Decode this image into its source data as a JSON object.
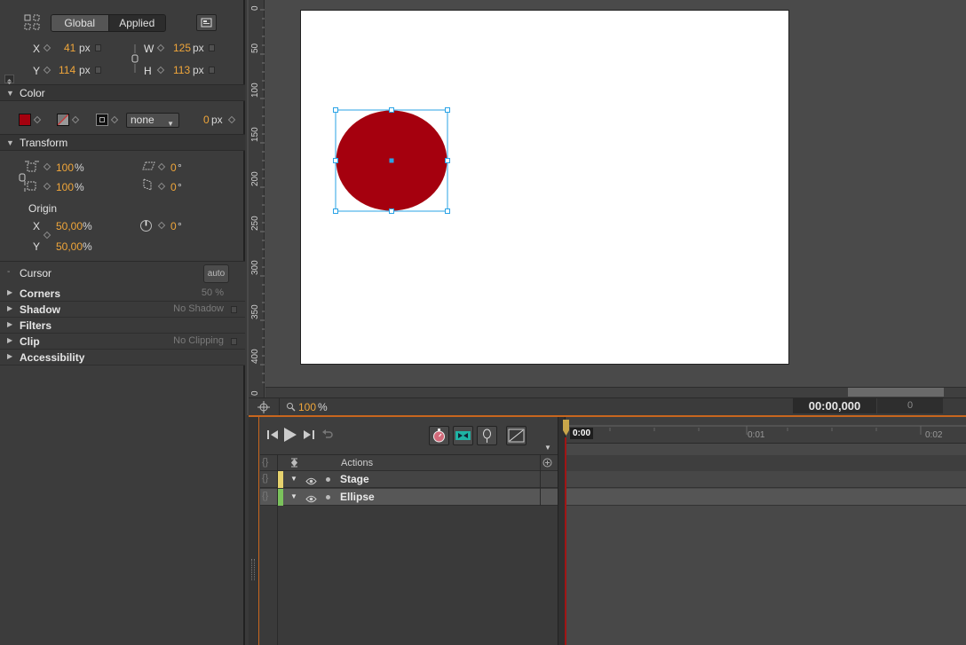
{
  "position": {
    "toggle": {
      "global": "Global",
      "applied": "Applied"
    },
    "x_label": "X",
    "x_value": "41",
    "x_unit": "px",
    "y_label": "Y",
    "y_value": "114",
    "y_unit": "px",
    "w_label": "W",
    "w_value": "125",
    "w_unit": "px",
    "h_label": "H",
    "h_value": "113",
    "h_unit": "px"
  },
  "color": {
    "section_title": "Color",
    "fill_color": "#a5000e",
    "stroke_style": "none",
    "stroke_width": "0",
    "stroke_unit": "px"
  },
  "transform": {
    "section_title": "Transform",
    "scale_x": "100",
    "scale_y": "100",
    "percent": "%",
    "skew_x": "0",
    "skew_y": "0",
    "degree": "°",
    "origin_label": "Origin",
    "origin_x_label": "X",
    "origin_x": "50,00",
    "origin_y_label": "Y",
    "origin_y": "50,00",
    "rotation": "0"
  },
  "cursor": {
    "label": "Cursor",
    "button": "auto"
  },
  "collapsed_sections": [
    {
      "title": "Corners",
      "value": "50 %"
    },
    {
      "title": "Shadow",
      "value": "No Shadow"
    },
    {
      "title": "Filters",
      "value": ""
    },
    {
      "title": "Clip",
      "value": "No Clipping"
    },
    {
      "title": "Accessibility",
      "value": ""
    }
  ],
  "ruler": {
    "ticks": [
      "0",
      "50",
      "100",
      "150",
      "200",
      "250",
      "300",
      "350",
      "400",
      "0"
    ]
  },
  "stage": {
    "zoom": "100",
    "zoom_unit": "%",
    "ellipse_color": "#a5000e",
    "time_display": "00:00,000",
    "frame_display": "0"
  },
  "timeline": {
    "playhead_time": "0:00",
    "ruler_marks": [
      "0:01",
      "0:02"
    ],
    "actions_label": "Actions",
    "layers": [
      {
        "name": "Stage",
        "tag_color": "#e6d26e"
      },
      {
        "name": "Ellipse",
        "tag_color": "#7bc25c"
      }
    ]
  }
}
